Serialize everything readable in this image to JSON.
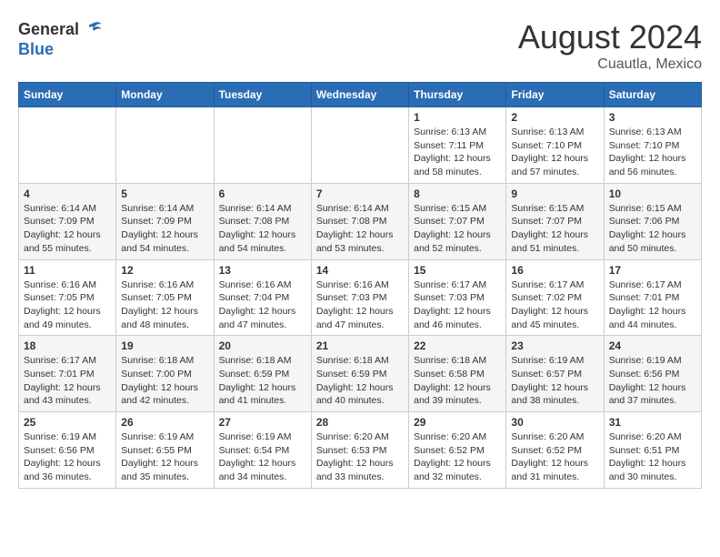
{
  "header": {
    "logo_general": "General",
    "logo_blue": "Blue",
    "month_year": "August 2024",
    "location": "Cuautla, Mexico"
  },
  "calendar": {
    "days_of_week": [
      "Sunday",
      "Monday",
      "Tuesday",
      "Wednesday",
      "Thursday",
      "Friday",
      "Saturday"
    ],
    "weeks": [
      [
        {
          "day": "",
          "info": ""
        },
        {
          "day": "",
          "info": ""
        },
        {
          "day": "",
          "info": ""
        },
        {
          "day": "",
          "info": ""
        },
        {
          "day": "1",
          "info": "Sunrise: 6:13 AM\nSunset: 7:11 PM\nDaylight: 12 hours\nand 58 minutes."
        },
        {
          "day": "2",
          "info": "Sunrise: 6:13 AM\nSunset: 7:10 PM\nDaylight: 12 hours\nand 57 minutes."
        },
        {
          "day": "3",
          "info": "Sunrise: 6:13 AM\nSunset: 7:10 PM\nDaylight: 12 hours\nand 56 minutes."
        }
      ],
      [
        {
          "day": "4",
          "info": "Sunrise: 6:14 AM\nSunset: 7:09 PM\nDaylight: 12 hours\nand 55 minutes."
        },
        {
          "day": "5",
          "info": "Sunrise: 6:14 AM\nSunset: 7:09 PM\nDaylight: 12 hours\nand 54 minutes."
        },
        {
          "day": "6",
          "info": "Sunrise: 6:14 AM\nSunset: 7:08 PM\nDaylight: 12 hours\nand 54 minutes."
        },
        {
          "day": "7",
          "info": "Sunrise: 6:14 AM\nSunset: 7:08 PM\nDaylight: 12 hours\nand 53 minutes."
        },
        {
          "day": "8",
          "info": "Sunrise: 6:15 AM\nSunset: 7:07 PM\nDaylight: 12 hours\nand 52 minutes."
        },
        {
          "day": "9",
          "info": "Sunrise: 6:15 AM\nSunset: 7:07 PM\nDaylight: 12 hours\nand 51 minutes."
        },
        {
          "day": "10",
          "info": "Sunrise: 6:15 AM\nSunset: 7:06 PM\nDaylight: 12 hours\nand 50 minutes."
        }
      ],
      [
        {
          "day": "11",
          "info": "Sunrise: 6:16 AM\nSunset: 7:05 PM\nDaylight: 12 hours\nand 49 minutes."
        },
        {
          "day": "12",
          "info": "Sunrise: 6:16 AM\nSunset: 7:05 PM\nDaylight: 12 hours\nand 48 minutes."
        },
        {
          "day": "13",
          "info": "Sunrise: 6:16 AM\nSunset: 7:04 PM\nDaylight: 12 hours\nand 47 minutes."
        },
        {
          "day": "14",
          "info": "Sunrise: 6:16 AM\nSunset: 7:03 PM\nDaylight: 12 hours\nand 47 minutes."
        },
        {
          "day": "15",
          "info": "Sunrise: 6:17 AM\nSunset: 7:03 PM\nDaylight: 12 hours\nand 46 minutes."
        },
        {
          "day": "16",
          "info": "Sunrise: 6:17 AM\nSunset: 7:02 PM\nDaylight: 12 hours\nand 45 minutes."
        },
        {
          "day": "17",
          "info": "Sunrise: 6:17 AM\nSunset: 7:01 PM\nDaylight: 12 hours\nand 44 minutes."
        }
      ],
      [
        {
          "day": "18",
          "info": "Sunrise: 6:17 AM\nSunset: 7:01 PM\nDaylight: 12 hours\nand 43 minutes."
        },
        {
          "day": "19",
          "info": "Sunrise: 6:18 AM\nSunset: 7:00 PM\nDaylight: 12 hours\nand 42 minutes."
        },
        {
          "day": "20",
          "info": "Sunrise: 6:18 AM\nSunset: 6:59 PM\nDaylight: 12 hours\nand 41 minutes."
        },
        {
          "day": "21",
          "info": "Sunrise: 6:18 AM\nSunset: 6:59 PM\nDaylight: 12 hours\nand 40 minutes."
        },
        {
          "day": "22",
          "info": "Sunrise: 6:18 AM\nSunset: 6:58 PM\nDaylight: 12 hours\nand 39 minutes."
        },
        {
          "day": "23",
          "info": "Sunrise: 6:19 AM\nSunset: 6:57 PM\nDaylight: 12 hours\nand 38 minutes."
        },
        {
          "day": "24",
          "info": "Sunrise: 6:19 AM\nSunset: 6:56 PM\nDaylight: 12 hours\nand 37 minutes."
        }
      ],
      [
        {
          "day": "25",
          "info": "Sunrise: 6:19 AM\nSunset: 6:56 PM\nDaylight: 12 hours\nand 36 minutes."
        },
        {
          "day": "26",
          "info": "Sunrise: 6:19 AM\nSunset: 6:55 PM\nDaylight: 12 hours\nand 35 minutes."
        },
        {
          "day": "27",
          "info": "Sunrise: 6:19 AM\nSunset: 6:54 PM\nDaylight: 12 hours\nand 34 minutes."
        },
        {
          "day": "28",
          "info": "Sunrise: 6:20 AM\nSunset: 6:53 PM\nDaylight: 12 hours\nand 33 minutes."
        },
        {
          "day": "29",
          "info": "Sunrise: 6:20 AM\nSunset: 6:52 PM\nDaylight: 12 hours\nand 32 minutes."
        },
        {
          "day": "30",
          "info": "Sunrise: 6:20 AM\nSunset: 6:52 PM\nDaylight: 12 hours\nand 31 minutes."
        },
        {
          "day": "31",
          "info": "Sunrise: 6:20 AM\nSunset: 6:51 PM\nDaylight: 12 hours\nand 30 minutes."
        }
      ]
    ]
  }
}
